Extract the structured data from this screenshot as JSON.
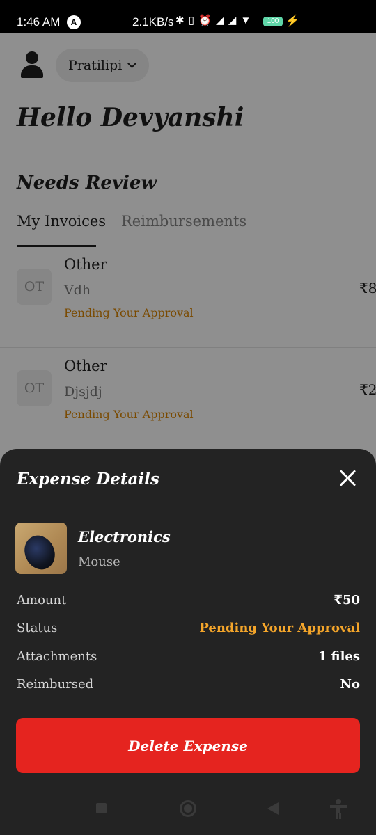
{
  "status_bar": {
    "time": "1:46 AM",
    "app_badge": "A",
    "net_speed": "2.1KB/s",
    "icons": [
      "bluetooth-icon",
      "vibrate-icon",
      "alarm-icon",
      "signal-icon",
      "signal-icon",
      "wifi-icon",
      "battery-icon",
      "charging-icon"
    ],
    "battery_level": "100"
  },
  "header": {
    "organization": "Pratilipi",
    "greeting": "Hello Devyanshi"
  },
  "review": {
    "title": "Needs Review",
    "tabs": [
      {
        "label": "My Invoices",
        "active": true
      },
      {
        "label": "Reimbursements",
        "active": false
      }
    ],
    "invoices": [
      {
        "badge": "OT",
        "type": "Other",
        "description": "Vdh",
        "status": "Pending Your Approval",
        "amount": "₹8"
      },
      {
        "badge": "OT",
        "type": "Other",
        "description": "Djsjdj",
        "status": "Pending Your Approval",
        "amount": "₹2"
      }
    ]
  },
  "sheet": {
    "title": "Expense Details",
    "category": "Electronics",
    "item": "Mouse",
    "rows": [
      {
        "label": "Amount",
        "value": "₹50"
      },
      {
        "label": "Status",
        "value": "Pending Your Approval"
      },
      {
        "label": "Attachments",
        "value": "1 files"
      },
      {
        "label": "Reimbursed",
        "value": "No"
      }
    ],
    "delete_label": "Delete Expense"
  },
  "colors": {
    "accent_orange": "#f4a52a",
    "delete_red": "#e5241f",
    "sheet_bg": "#232323"
  }
}
